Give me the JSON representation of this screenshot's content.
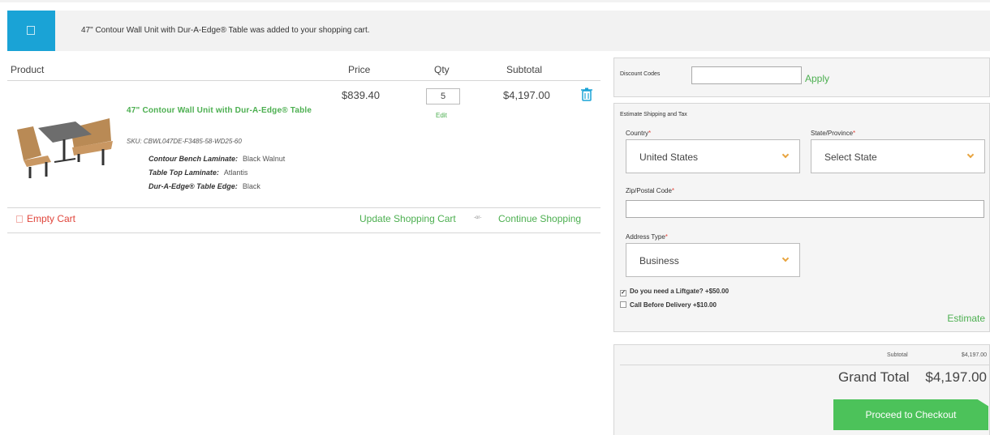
{
  "notice": {
    "message": "47\" Contour Wall Unit with Dur-A-Edge® Table was added to your shopping cart."
  },
  "cart": {
    "headers": {
      "product": "Product",
      "price": "Price",
      "qty": "Qty",
      "subtotal": "Subtotal"
    },
    "item": {
      "name": "47\" Contour Wall Unit with Dur-A-Edge® Table",
      "sku": "SKU: CBWL047DE-F3485-58-WD25-60",
      "options": [
        {
          "label": "Contour Bench Laminate:",
          "value": "Black Walnut"
        },
        {
          "label": "Table Top Laminate:",
          "value": "Atlantis"
        },
        {
          "label": "Dur-A-Edge® Table Edge:",
          "value": "Black"
        }
      ],
      "price": "$839.40",
      "qty": "5",
      "edit": "Edit",
      "subtotal": "$4,197.00"
    },
    "actions": {
      "empty_cart": "Empty Cart",
      "update_cart": "Update Shopping Cart",
      "or": "-or-",
      "continue": "Continue Shopping"
    }
  },
  "discount": {
    "label": "Discount Codes",
    "apply": "Apply"
  },
  "estimate": {
    "title": "Estimate Shipping and Tax",
    "country_label": "Country",
    "country_value": "United States",
    "state_label": "State/Province",
    "state_value": "Select State",
    "zip_label": "Zip/Postal Code",
    "address_type_label": "Address Type",
    "address_type_value": "Business",
    "liftgate": "Do you need a Liftgate? +$50.00",
    "call_before": "Call Before Delivery +$10.00",
    "estimate_link": "Estimate",
    "required_mark": "*"
  },
  "totals": {
    "subtotal_label": "Subtotal",
    "subtotal_value": "$4,197.00",
    "grand_total_label": "Grand Total",
    "grand_total_value": "$4,197.00",
    "checkout": "Proceed to Checkout"
  },
  "colors": {
    "accent_green": "#4caf50",
    "notice_blue": "#1aa3d6",
    "danger_red": "#e0453b",
    "chevron_orange": "#e8a33d",
    "checkout_green": "#4cc25a"
  }
}
